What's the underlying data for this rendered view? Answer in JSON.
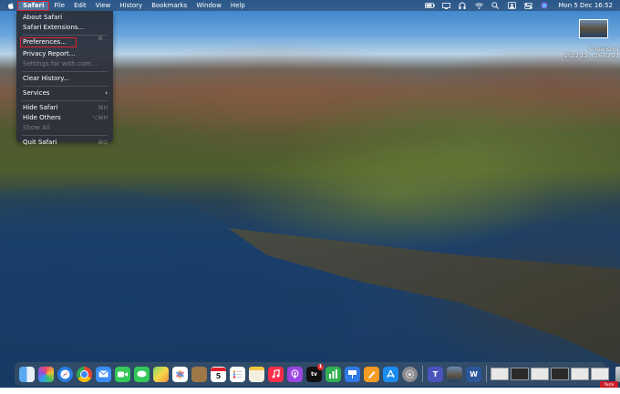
{
  "menubar": {
    "app_menu": "Safari",
    "menus": [
      "File",
      "Edit",
      "View",
      "History",
      "Bookmarks",
      "Window",
      "Help"
    ],
    "clock": "Mon 5 Dec  16:52"
  },
  "safari_menu": {
    "about": "About Safari",
    "extensions": "Safari Extensions...",
    "preferences": "Preferences...",
    "preferences_shortcut": "⌘ ,",
    "privacy_report": "Privacy Report...",
    "settings_site": "Settings for with.com...",
    "clear_history": "Clear History...",
    "services": "Services",
    "hide_safari": "Hide Safari",
    "hide_safari_shortcut": "⌘H",
    "hide_others": "Hide Others",
    "hide_others_shortcut": "⌥⌘H",
    "show_all": "Show All",
    "quit": "Quit Safari",
    "quit_shortcut": "⌘Q"
  },
  "desktop": {
    "screenshot_label_line1": "Screenshot",
    "screenshot_label_line2": "2022-12-...16.52.21"
  },
  "dock": {
    "calendar_day": "5",
    "tv_label": "tv",
    "tv_badge": "1",
    "corner_tag": "Paste Icon"
  },
  "colors": {
    "highlight": "#e02030",
    "menu_bg": "#2c303a"
  }
}
